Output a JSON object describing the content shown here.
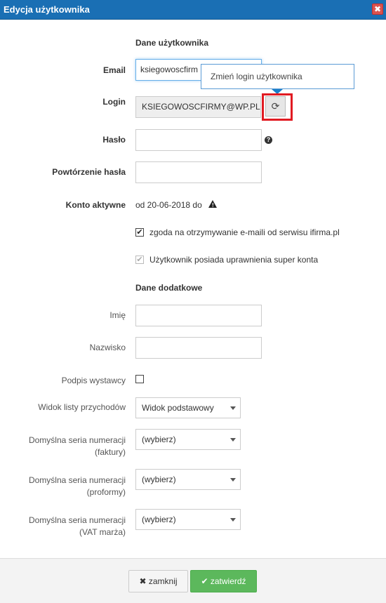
{
  "window": {
    "title": "Edycja użytkownika",
    "close_glyph": "✖"
  },
  "sections": {
    "user_data": "Dane użytkownika",
    "extra_data": "Dane dodatkowe"
  },
  "fields": {
    "email": {
      "label": "Email",
      "value": "ksiegowoscfirm"
    },
    "login": {
      "label": "Login",
      "value": "KSIEGOWOSCFIRMY@WP.PL"
    },
    "password": {
      "label": "Hasło"
    },
    "password_repeat": {
      "label": "Powtórzenie hasła"
    },
    "account_active": {
      "label": "Konto aktywne",
      "value": "od 20-06-2018 do"
    },
    "first_name": {
      "label": "Imię"
    },
    "last_name": {
      "label": "Nazwisko"
    },
    "issuer_signature": {
      "label": "Podpis wystawcy",
      "checked": false
    },
    "income_list_view": {
      "label": "Widok listy przychodów",
      "selected": "Widok podstawowy"
    },
    "series_invoices": {
      "label_line1": "Domyślna seria numeracji",
      "label_line2": "(faktury)",
      "selected": "(wybierz)"
    },
    "series_proforma": {
      "label_line1": "Domyślna seria numeracji",
      "label_line2": "(proformy)",
      "selected": "(wybierz)"
    },
    "series_vat_margin": {
      "label_line1": "Domyślna seria numeracji",
      "label_line2": "(VAT marża)",
      "selected": "(wybierz)"
    }
  },
  "checkboxes": {
    "email_consent": {
      "label": "zgoda na otrzymywanie e-maili od serwisu ifirma.pl",
      "checked": true
    },
    "super_account": {
      "label": "Użytkownik posiada uprawnienia super konta",
      "checked": true,
      "disabled": true
    }
  },
  "tooltip": {
    "text": "Zmień login użytkownika"
  },
  "icons": {
    "refresh": "refresh-icon",
    "help": "question-circle-icon",
    "warning": "warning-triangle-icon",
    "close": "close-icon",
    "check": "check-icon"
  },
  "buttons": {
    "close_label": "zamknij",
    "confirm_label": "zatwierdź"
  },
  "colors": {
    "title_bar": "#1a6fb4",
    "confirm": "#5cb85c",
    "highlight": "#e11b22",
    "close": "#d9534f"
  }
}
